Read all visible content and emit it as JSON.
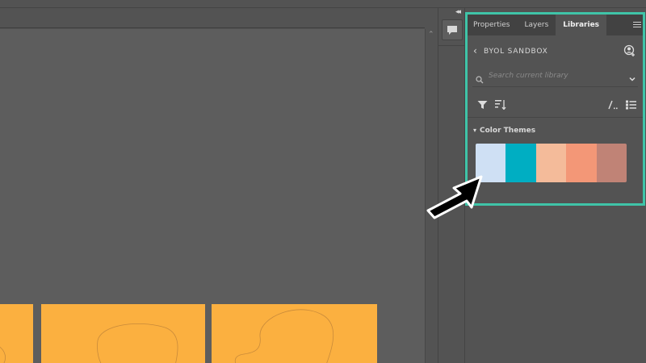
{
  "panel": {
    "tabs": [
      {
        "label": "Properties",
        "active": false
      },
      {
        "label": "Layers",
        "active": false
      },
      {
        "label": "Libraries",
        "active": true
      }
    ],
    "library_name": "BYOL SANDBOX",
    "search_placeholder": "Search current library",
    "group": {
      "title": "Color Themes",
      "swatches": [
        "#cfe0f4",
        "#00aec2",
        "#f4bb9a",
        "#f39777",
        "#c08376"
      ]
    }
  },
  "colors": {
    "highlight": "#3fc4a8",
    "artboard": "#fbb040",
    "canvas": "#5d5d5d",
    "ui_bg": "#535353"
  },
  "icons": [
    "collapse-arrows-icon",
    "comment-icon",
    "menu-icon",
    "chevron-left-icon",
    "user-add-icon",
    "search-icon",
    "chevron-down-icon",
    "filter-icon",
    "sort-icon",
    "slash-view-icon",
    "list-view-icon",
    "cursor-arrow-icon"
  ]
}
